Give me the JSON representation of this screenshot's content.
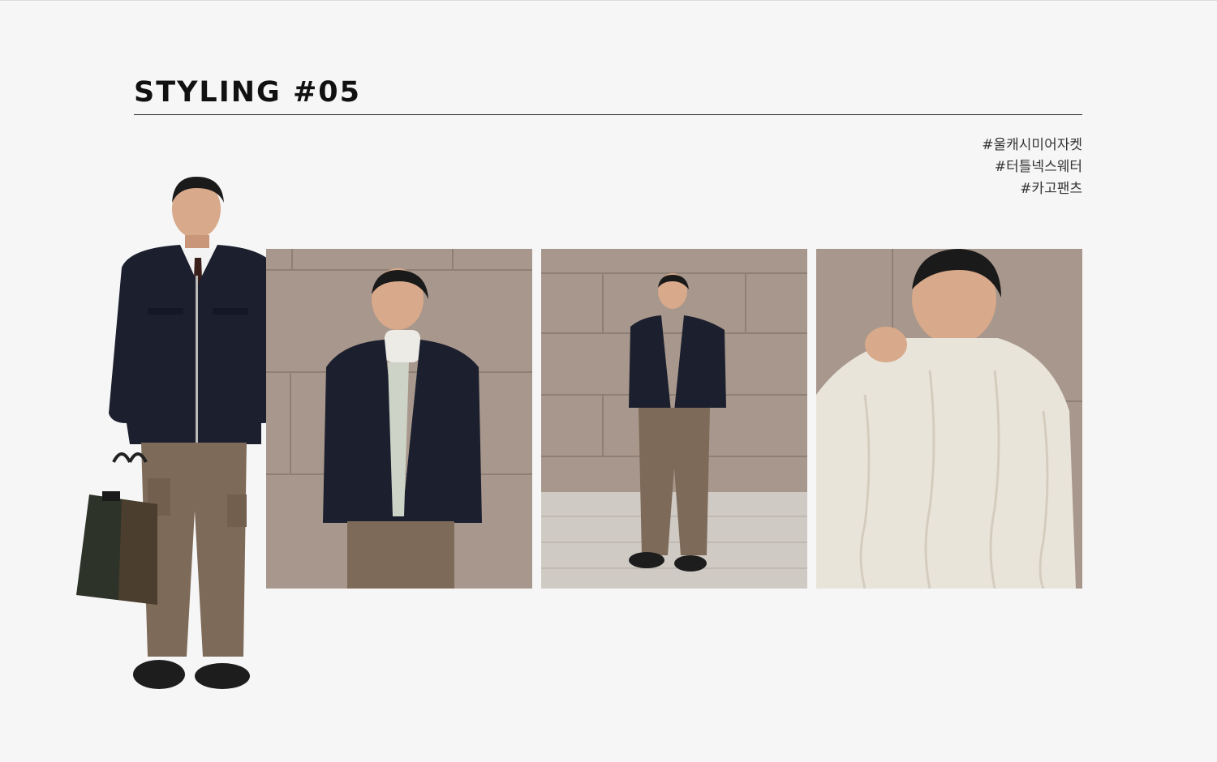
{
  "page": {
    "title": "STYLING #05",
    "background_color": "#f6f6f6",
    "text_color": "#111111"
  },
  "tags": [
    "#울캐시미어자켓",
    "#터틀넥스웨터",
    "#카고팬츠"
  ],
  "images": [
    {
      "name": "full-body-cutout",
      "subject": "man in navy wool jacket, brown cargo pants, holding tote bag"
    },
    {
      "name": "photo-upper-body",
      "subject": "man in navy jacket and turtleneck against stone wall"
    },
    {
      "name": "photo-full-body",
      "subject": "man standing in front of stone wall on tiled ground"
    },
    {
      "name": "photo-turtleneck-closeup",
      "subject": "man pulling up cream cable-knit turtleneck"
    }
  ],
  "colors": {
    "jacket": "#1b1f2e",
    "pants": "#7d6a58",
    "wall": "#a8978c",
    "sweater": "#e9e4da"
  }
}
